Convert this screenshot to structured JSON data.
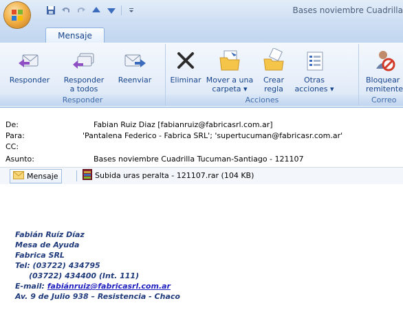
{
  "window": {
    "title": "Bases noviembre Cuadrilla"
  },
  "tabs": [
    {
      "label": "Mensaje"
    }
  ],
  "ribbon": {
    "groups": [
      {
        "label": "Responder",
        "buttons": [
          "Responder",
          "Responder\na todos",
          "Reenviar"
        ]
      },
      {
        "label": "Acciones",
        "buttons": [
          "Eliminar",
          "Mover a una\ncarpeta ▾",
          "Crear\nregla",
          "Otras\nacciones ▾"
        ]
      },
      {
        "label": "Correo",
        "buttons": [
          "Bloquear\nremitente"
        ]
      }
    ]
  },
  "header": {
    "from_label": "De:",
    "from_value": "Fabian Ruiz Diaz [fabianruiz@fabricasrl.com.ar]",
    "to_label": "Para:",
    "to_value": "'Pantalena Federico - Fabrica SRL'; 'supertucuman@fabricasr.com.ar'",
    "cc_label": "CC:",
    "cc_value": "",
    "subject_label": "Asunto:",
    "subject_value": "Bases noviembre Cuadrilla Tucuman-Santiago - 121107"
  },
  "attachments": {
    "message_label": "Mensaje",
    "file_label": "Subida uras peralta - 121107.rar (104 KB)"
  },
  "signature": {
    "name": "Fabián Ruíz Díaz",
    "role": "Mesa de Ayuda",
    "company": "Fabrica SRL",
    "tel1": "Tel: (03722) 434795",
    "tel2": "(03722) 434400 (Int. 111)",
    "email_label": "E-mail: ",
    "email_link": "fabiánruiz@fabricasrl.com.ar",
    "address": "Av. 9 de Julio 938 – Resistencia - Chaco"
  },
  "colors": {
    "accent": "#15428b",
    "ribbon_bg": "#e6eef9",
    "signature": "#1f3a7a"
  }
}
